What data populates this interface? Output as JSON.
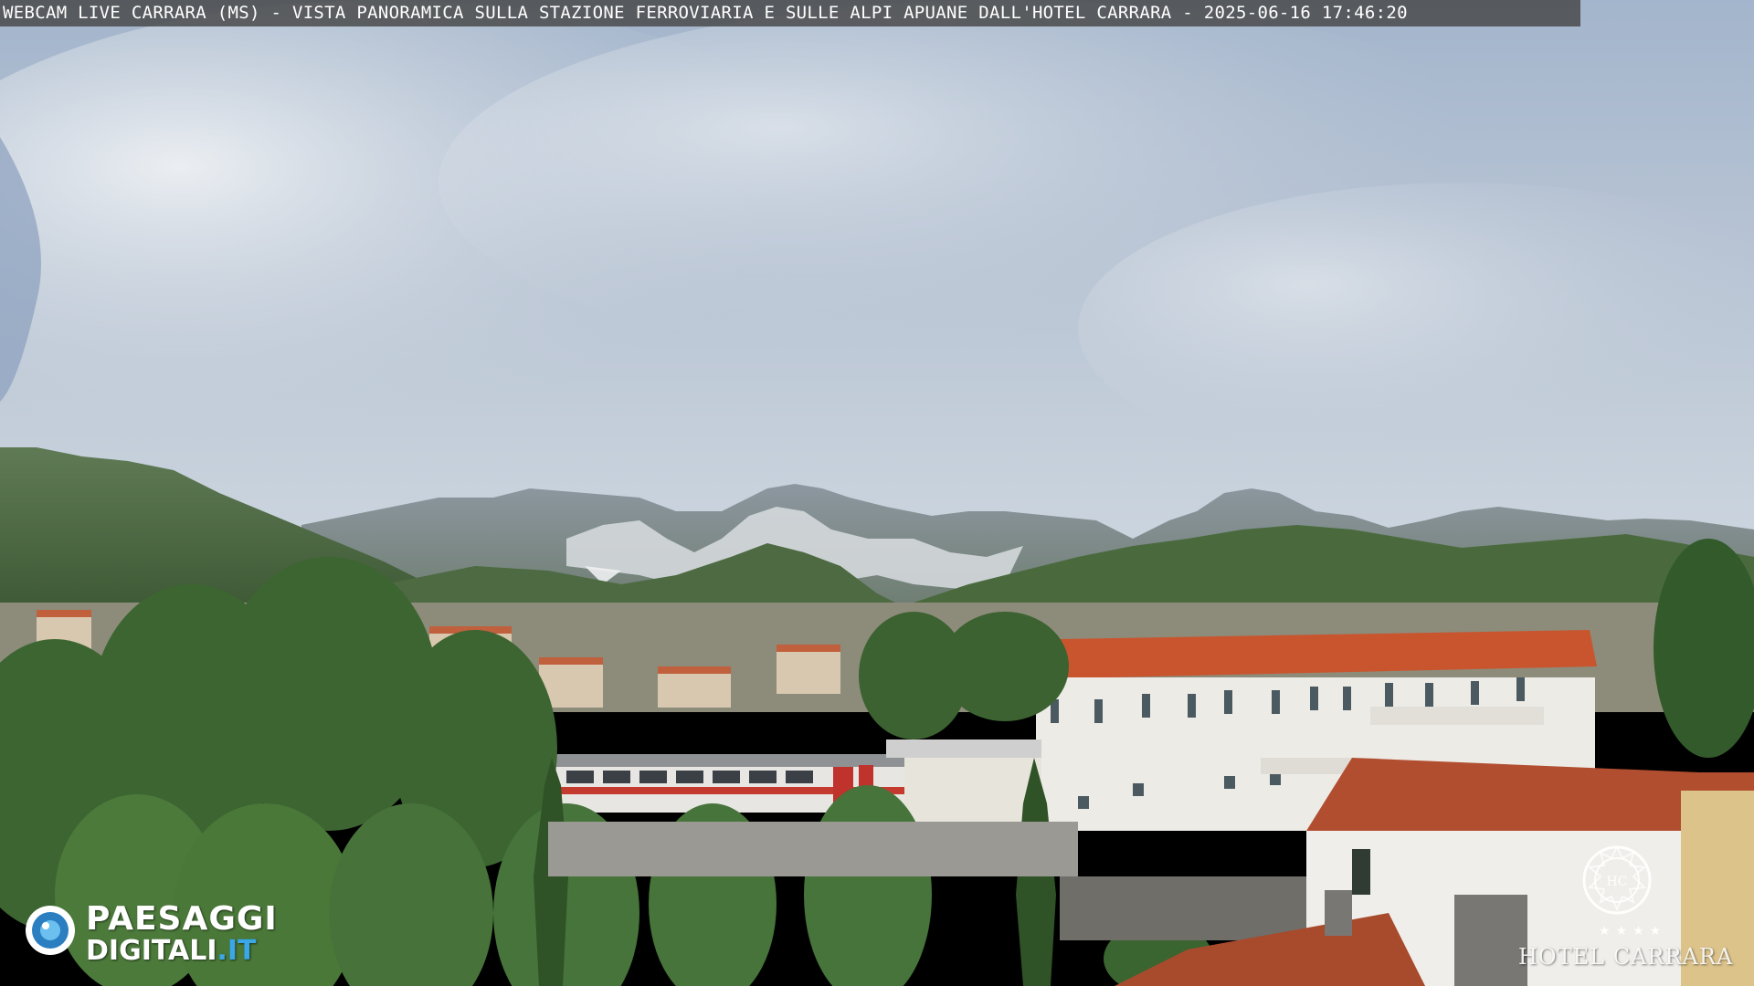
{
  "overlay": {
    "caption": "WEBCAM LIVE CARRARA (MS) - VISTA PANORAMICA SULLA STAZIONE FERROVIARIA E SULLE ALPI APUANE DALL'HOTEL CARRARA - 2025-06-16 17:46:20"
  },
  "watermark_left": {
    "line1": "PAESAGGI",
    "line2_main": "DIGITALI",
    "line2_tld": ".IT",
    "icon": "camera-lens-icon"
  },
  "watermark_right": {
    "name": "HOTEL CARRARA",
    "icon": "hotel-crest-icon",
    "stars": "★★★★"
  },
  "colors": {
    "sky_top": "#9fb3cc",
    "sky_bottom": "#c8d3de",
    "roof": "#c9552f",
    "station_wall": "#ecebe6",
    "vegetation": "#3f6b2f",
    "brand_accent": "#3aa7e6"
  }
}
